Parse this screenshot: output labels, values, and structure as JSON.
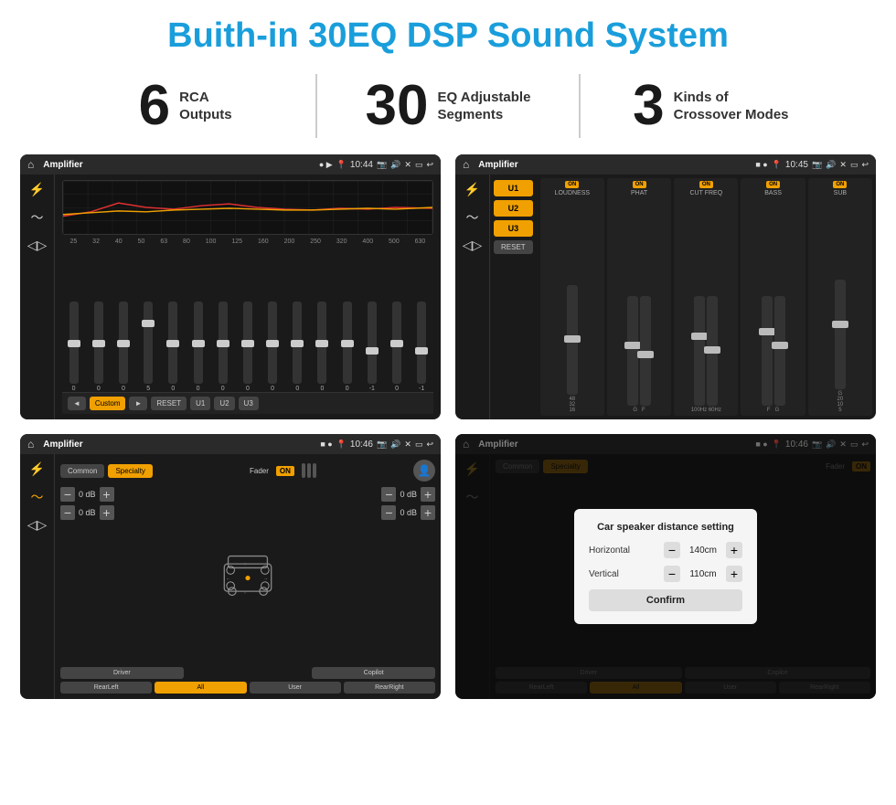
{
  "title": "Buith-in 30EQ DSP Sound System",
  "stats": [
    {
      "number": "6",
      "label": "RCA\nOutputs"
    },
    {
      "number": "30",
      "label": "EQ Adjustable\nSegments"
    },
    {
      "number": "3",
      "label": "Kinds of\nCrossover Modes"
    }
  ],
  "screens": [
    {
      "id": "eq",
      "statusBar": {
        "title": "Amplifier",
        "time": "10:44",
        "dots": "● ▶"
      },
      "eqFreqs": [
        "25",
        "32",
        "40",
        "50",
        "63",
        "80",
        "100",
        "125",
        "160",
        "200",
        "250",
        "320",
        "400",
        "500",
        "630"
      ],
      "eqValues": [
        "0",
        "0",
        "0",
        "5",
        "0",
        "0",
        "0",
        "0",
        "0",
        "0",
        "0",
        "0",
        "-1",
        "0",
        "-1"
      ],
      "bottomBtns": [
        "◄",
        "Custom",
        "►",
        "RESET",
        "U1",
        "U2",
        "U3"
      ]
    },
    {
      "id": "crossover",
      "statusBar": {
        "title": "Amplifier",
        "time": "10:45",
        "dots": "■ ●"
      },
      "uButtons": [
        "U1",
        "U2",
        "U3"
      ],
      "channels": [
        {
          "name": "LOUDNESS",
          "on": true
        },
        {
          "name": "PHAT",
          "on": true
        },
        {
          "name": "CUT FREQ",
          "on": true
        },
        {
          "name": "BASS",
          "on": true
        },
        {
          "name": "SUB",
          "on": true
        }
      ],
      "resetBtn": "RESET"
    },
    {
      "id": "speaker",
      "statusBar": {
        "title": "Amplifier",
        "time": "10:46",
        "dots": "■ ●"
      },
      "tabs": [
        "Common",
        "Specialty"
      ],
      "activeTab": "Specialty",
      "fader": "Fader",
      "faderOn": "ON",
      "leftDb": [
        "0 dB",
        "0 dB"
      ],
      "rightDb": [
        "0 dB",
        "0 dB"
      ],
      "bottomBtns": [
        "Driver",
        "",
        "Copilot",
        "RearLeft",
        "All",
        "User",
        "RearRight"
      ],
      "activeBottom": "All"
    },
    {
      "id": "speaker-dialog",
      "statusBar": {
        "title": "Amplifier",
        "time": "10:46",
        "dots": "■ ●"
      },
      "tabs": [
        "Common",
        "Specialty"
      ],
      "dialog": {
        "title": "Car speaker distance setting",
        "horizontal": {
          "label": "Horizontal",
          "value": "140cm"
        },
        "vertical": {
          "label": "Vertical",
          "value": "110cm"
        },
        "confirmBtn": "Confirm"
      },
      "bottomBtns": [
        "Driver",
        "Copilot",
        "RearLeft",
        "All",
        "User",
        "RearRight"
      ]
    }
  ],
  "colors": {
    "accent": "#f0a000",
    "titleBlue": "#1a9edb",
    "dark": "#1a1a1a",
    "medium": "#333333"
  }
}
